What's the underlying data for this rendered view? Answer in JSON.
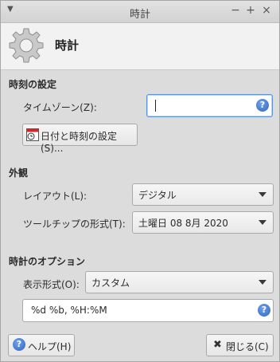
{
  "window": {
    "title": "時計",
    "menu_icon": "chevron-down-icon",
    "minimize": "−",
    "maximize": "+",
    "close": "×"
  },
  "header": {
    "title": "時計",
    "icon": "gear-icon"
  },
  "time_settings": {
    "section": "時刻の設定",
    "timezone_label": "タイムゾーン(Z):",
    "timezone_value": "",
    "datetime_button": "日付と時刻の設定(S)..."
  },
  "appearance": {
    "section": "外観",
    "layout_label": "レイアウト(L):",
    "layout_value": "デジタル",
    "tooltip_label": "ツールチップの形式(T):",
    "tooltip_value": "土曜日 08 8月 2020"
  },
  "clock_options": {
    "section": "時計のオプション",
    "format_label": "表示形式(O):",
    "format_value": "カスタム",
    "custom_format": "%d %b, %H:%M"
  },
  "footer": {
    "help_button": "ヘルプ(H)",
    "close_button": "閉じる(C)"
  },
  "colors": {
    "accent": "#2f65c6",
    "focus_border": "#5b94d7",
    "calendar_red": "#c62d2d"
  }
}
